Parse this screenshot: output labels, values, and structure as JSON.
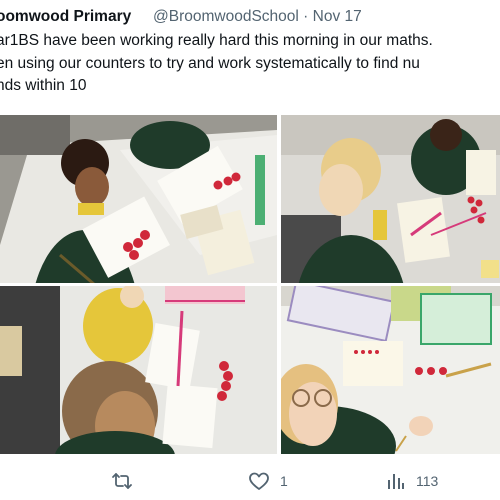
{
  "tweet": {
    "author_name": "oomwood Primary",
    "handle": "@BroomwoodSchool",
    "separator": "·",
    "date": "Nov 17",
    "text_lines": [
      "ar1BS have been working really hard this morning in our maths.",
      "en using our counters to try and work systematically to find nu",
      "nds within 10"
    ]
  },
  "media": {
    "photos": [
      {
        "name": "photo-boy-with-counters"
      },
      {
        "name": "photo-girl-with-counters"
      },
      {
        "name": "photo-child-placing-counters"
      },
      {
        "name": "photo-girl-smiling-at-table"
      }
    ]
  },
  "actions": {
    "retweet_icon": "retweet-icon",
    "like_icon": "heart-icon",
    "like_count": "1",
    "views_icon": "views-chart-icon",
    "views_count": "113"
  },
  "colors": {
    "text": "#0f1419",
    "secondary": "#536471",
    "counter_red": "#d0283a",
    "uniform_green": "#1f3b2a",
    "uniform_yellow": "#e5c63a"
  }
}
